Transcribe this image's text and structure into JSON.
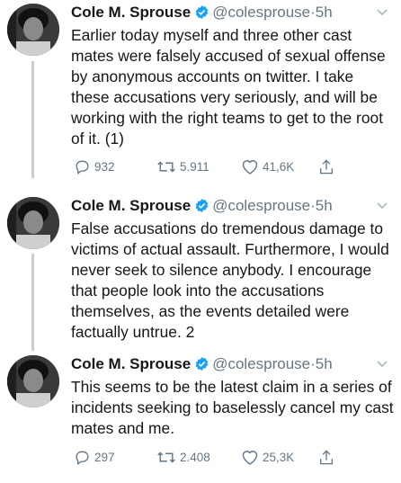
{
  "tweets": [
    {
      "name": "Cole M. Sprouse",
      "handle": "@colesprouse",
      "separator": "·",
      "time": "5h",
      "text": "Earlier today myself and three other cast mates were falsely accused of sexual offense by anonymous accounts on twitter. I take these accusations very seriously, and will be working with the right teams to get to the root of it. (1)",
      "replies": "932",
      "retweets": "5.911",
      "likes": "41,6K"
    },
    {
      "name": "Cole M. Sprouse",
      "handle": "@colesprouse",
      "separator": "·",
      "time": "5h",
      "text": "False accusations do tremendous damage to victims of actual assault. Furthermore, I would never seek to silence anybody. I encourage that people look into the accusations themselves, as the events detailed were factually untrue. 2"
    },
    {
      "name": "Cole M. Sprouse",
      "handle": "@colesprouse",
      "separator": "·",
      "time": "5h",
      "text": "This seems to be the latest claim in a series of incidents seeking to baselessly cancel my cast mates and me.",
      "replies": "297",
      "retweets": "2.408",
      "likes": "25,3K"
    }
  ],
  "icons": {
    "verified": "verified-badge-icon",
    "menu": "chevron-down-icon",
    "reply": "reply-icon",
    "retweet": "retweet-icon",
    "like": "heart-icon",
    "share": "share-icon"
  },
  "colors": {
    "text": "#14171a",
    "secondary": "#657786",
    "verified_blue": "#1da1f2",
    "thread_line": "#c4cfd6"
  }
}
